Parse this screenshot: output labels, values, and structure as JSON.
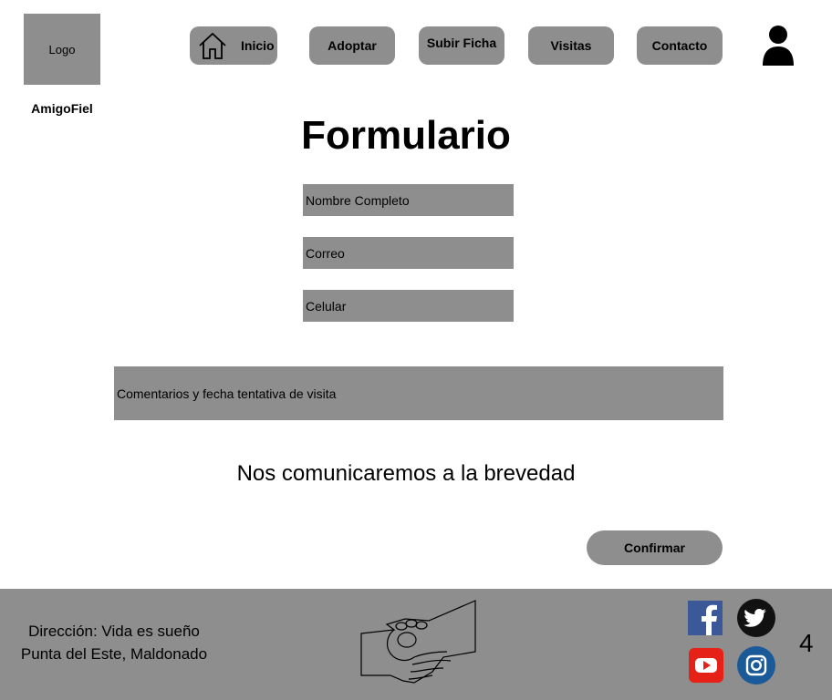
{
  "header": {
    "logo_text": "Logo",
    "brand_name": "AmigoFiel",
    "nav": [
      {
        "label": "Inicio",
        "icon": "home-icon"
      },
      {
        "label": "Adoptar"
      },
      {
        "label": "Subir Ficha"
      },
      {
        "label": "Visitas"
      },
      {
        "label": "Contacto"
      }
    ],
    "user_icon": "user-icon"
  },
  "main": {
    "title": "Formulario",
    "fields": {
      "name_placeholder": "Nombre Completo",
      "email_placeholder": "Correo",
      "phone_placeholder": "Celular",
      "comments_placeholder": "Comentarios y fecha tentativa de visita"
    },
    "message": "Nos comunicaremos a la brevedad",
    "confirm_label": "Confirmar"
  },
  "footer": {
    "address_line1": "Dirección: Vida es sueño",
    "address_line2": "Punta del Este, Maldonado",
    "center_icon": "handshake-paw-icon",
    "social": [
      "facebook-icon",
      "twitter-icon",
      "youtube-icon",
      "instagram-icon"
    ],
    "page_number": "4"
  },
  "colors": {
    "panel_gray": "#8e8e8e",
    "facebook": "#3b5998",
    "twitter": "#111111",
    "youtube": "#e62117",
    "instagram": "#1a5a99"
  }
}
